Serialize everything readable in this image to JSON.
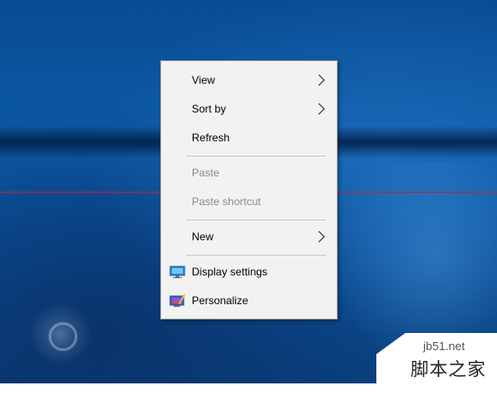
{
  "context_menu": {
    "items": [
      {
        "label": "View",
        "has_submenu": true,
        "enabled": true
      },
      {
        "label": "Sort by",
        "has_submenu": true,
        "enabled": true
      },
      {
        "label": "Refresh",
        "has_submenu": false,
        "enabled": true
      },
      {
        "label": "Paste",
        "has_submenu": false,
        "enabled": false
      },
      {
        "label": "Paste shortcut",
        "has_submenu": false,
        "enabled": false
      },
      {
        "label": "New",
        "has_submenu": true,
        "enabled": true
      },
      {
        "label": "Display settings",
        "icon": "monitor-icon",
        "enabled": true
      },
      {
        "label": "Personalize",
        "icon": "personalize-icon",
        "enabled": true
      }
    ]
  },
  "watermark": {
    "url": "jb51.net",
    "name": "脚本之家"
  },
  "colors": {
    "desktop_blue": "#0b5aa8",
    "menu_bg": "#f2f2f2",
    "disabled_text": "#8c8c8c",
    "red_line": "#d21d1d"
  }
}
